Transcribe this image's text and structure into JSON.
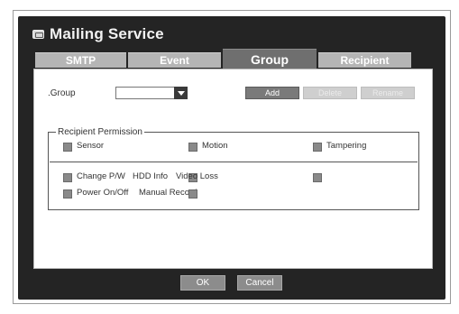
{
  "window": {
    "title": "Mailing Service",
    "title_icon": "mail-icon"
  },
  "tabs": [
    {
      "label": "SMTP",
      "active": false
    },
    {
      "label": "Event",
      "active": false
    },
    {
      "label": "Group",
      "active": true
    },
    {
      "label": "Recipient",
      "active": false
    }
  ],
  "group": {
    "label": ".Group",
    "value": "",
    "add_label": "Add",
    "delete_label": "Delete",
    "rename_label": "Rename"
  },
  "permission": {
    "legend": "Recipient Permission",
    "items": [
      {
        "label": "Sensor"
      },
      {
        "label": "Motion"
      },
      {
        "label": "Tampering"
      },
      {
        "label": "Change P/W"
      },
      {
        "label": "HDD Info"
      },
      {
        "label": "Video Loss"
      },
      {
        "label": "Power On/Off"
      },
      {
        "label": "Manual Record"
      }
    ]
  },
  "footer": {
    "ok_label": "OK",
    "cancel_label": "Cancel"
  }
}
